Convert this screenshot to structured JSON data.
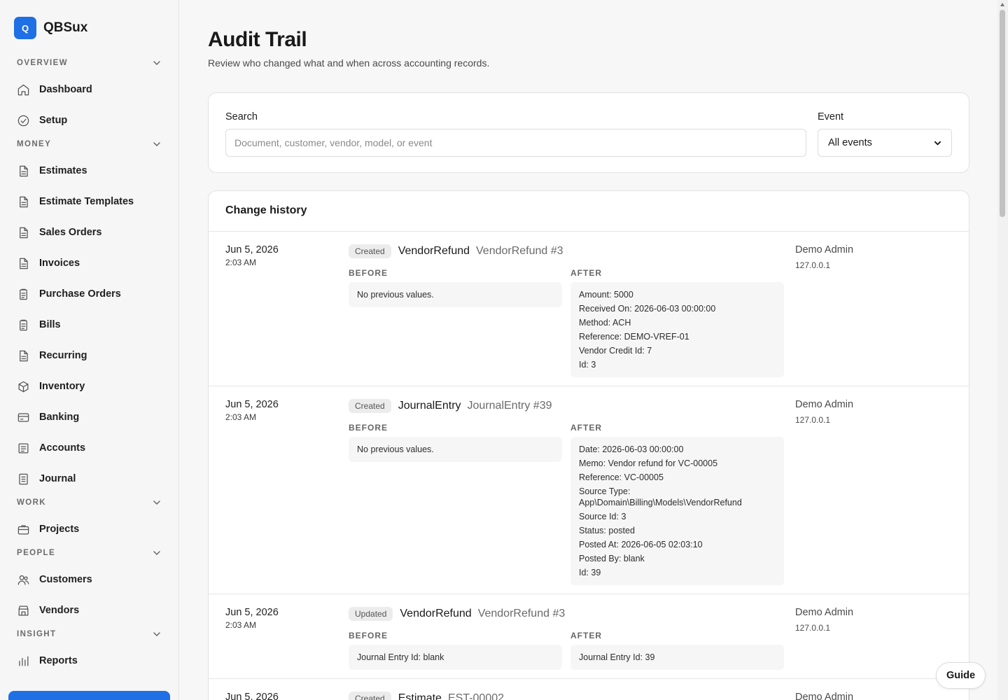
{
  "brand": {
    "logo_letter": "Q",
    "name": "QBSux"
  },
  "sidebar": {
    "sections": [
      {
        "label": "OVERVIEW",
        "items": [
          {
            "label": "Dashboard",
            "icon": "home-icon"
          },
          {
            "label": "Setup",
            "icon": "check-circle-icon"
          }
        ]
      },
      {
        "label": "MONEY",
        "items": [
          {
            "label": "Estimates",
            "icon": "document-icon"
          },
          {
            "label": "Estimate Templates",
            "icon": "document-icon"
          },
          {
            "label": "Sales Orders",
            "icon": "document-icon"
          },
          {
            "label": "Invoices",
            "icon": "document-icon"
          },
          {
            "label": "Purchase Orders",
            "icon": "clipboard-icon"
          },
          {
            "label": "Bills",
            "icon": "clipboard-icon"
          },
          {
            "label": "Recurring",
            "icon": "document-icon"
          },
          {
            "label": "Inventory",
            "icon": "box-icon"
          },
          {
            "label": "Banking",
            "icon": "card-icon"
          },
          {
            "label": "Accounts",
            "icon": "ledger-icon"
          },
          {
            "label": "Journal",
            "icon": "journal-icon"
          }
        ]
      },
      {
        "label": "WORK",
        "items": [
          {
            "label": "Projects",
            "icon": "briefcase-icon"
          }
        ]
      },
      {
        "label": "PEOPLE",
        "items": [
          {
            "label": "Customers",
            "icon": "users-icon"
          },
          {
            "label": "Vendors",
            "icon": "store-icon"
          }
        ]
      },
      {
        "label": "INSIGHT",
        "items": [
          {
            "label": "Reports",
            "icon": "bar-chart-icon"
          }
        ]
      }
    ]
  },
  "page": {
    "title": "Audit Trail",
    "subtitle": "Review who changed what and when across accounting records."
  },
  "filters": {
    "search_label": "Search",
    "search_placeholder": "Document, customer, vendor, model, or event",
    "search_value": "",
    "event_label": "Event",
    "event_selected": "All events"
  },
  "history": {
    "title": "Change history",
    "before_label": "BEFORE",
    "after_label": "AFTER",
    "rows": [
      {
        "date": "Jun 5, 2026",
        "time": "2:03 AM",
        "event": "Created",
        "model": "VendorRefund",
        "record": "VendorRefund #3",
        "before": [
          "No previous values."
        ],
        "after": [
          "Amount: 5000",
          "Received On: 2026-06-03 00:00:00",
          "Method: ACH",
          "Reference: DEMO-VREF-01",
          "Vendor Credit Id: 7",
          "Id: 3"
        ],
        "user": "Demo Admin",
        "ip": "127.0.0.1"
      },
      {
        "date": "Jun 5, 2026",
        "time": "2:03 AM",
        "event": "Created",
        "model": "JournalEntry",
        "record": "JournalEntry #39",
        "before": [
          "No previous values."
        ],
        "after": [
          "Date: 2026-06-03 00:00:00",
          "Memo: Vendor refund for VC-00005",
          "Reference: VC-00005",
          "Source Type: App\\Domain\\Billing\\Models\\VendorRefund",
          "Source Id: 3",
          "Status: posted",
          "Posted At: 2026-06-05 02:03:10",
          "Posted By: blank",
          "Id: 39"
        ],
        "user": "Demo Admin",
        "ip": "127.0.0.1"
      },
      {
        "date": "Jun 5, 2026",
        "time": "2:03 AM",
        "event": "Updated",
        "model": "VendorRefund",
        "record": "VendorRefund #3",
        "before": [
          "Journal Entry Id: blank"
        ],
        "after": [
          "Journal Entry Id: 39"
        ],
        "user": "Demo Admin",
        "ip": "127.0.0.1"
      },
      {
        "date": "Jun 5, 2026",
        "time": "",
        "event": "Created",
        "model": "Estimate",
        "record": "EST-00002",
        "before": [],
        "after": [],
        "user": "Demo Admin",
        "ip": ""
      }
    ]
  },
  "guide_button": "Guide",
  "colors": {
    "accent": "#1f6fe5",
    "badge_bg": "#ececec",
    "box_bg": "#f6f6f6"
  }
}
